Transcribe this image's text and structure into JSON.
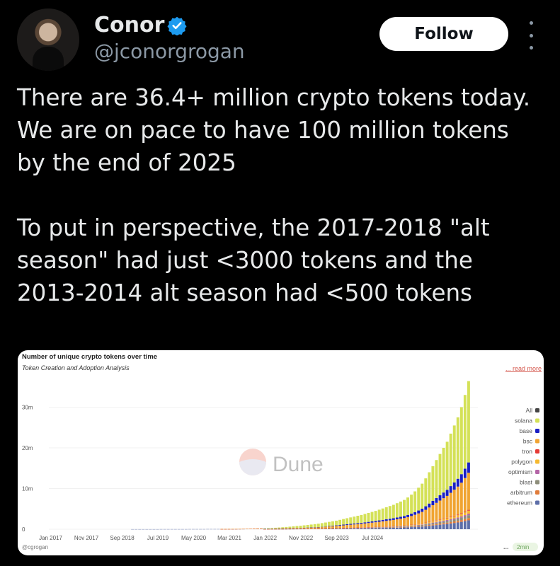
{
  "author": {
    "name": "Conor",
    "handle": "@jconorgrogan",
    "follow_label": "Follow"
  },
  "tweet": {
    "paragraph1": "There are 36.4+ million crypto tokens today. We are on pace to have 100 million tokens by the end of 2025",
    "paragraph2": "To put in perspective, the  2017-2018 \"alt season\" had just <3000 tokens and the 2013-2014 alt season had <500 tokens"
  },
  "colors": {
    "background": "#000000",
    "verified": "#1d9bf0",
    "solana": "#d4e157",
    "base": "#1a1fc4",
    "bsc": "#f0a431",
    "tron": "#e53935",
    "polygon": "#f5b930",
    "optimism": "#b565a7",
    "blast": "#8d8d7a",
    "arbitrum": "#e07b39",
    "ethereum": "#5d6ea8",
    "all": "#444444"
  },
  "card": {
    "title": "Number of unique crypto tokens over time",
    "subtitle": "Token Creation and Adoption Analysis",
    "read_more": "... read more",
    "watermark": "Dune",
    "credit": "@cgrogan",
    "footer_dots": "...",
    "footer_badge": "2min"
  },
  "chart_data": {
    "type": "bar",
    "stacked": true,
    "title": "Number of unique crypto tokens over time",
    "subtitle": "Token Creation and Adoption Analysis",
    "y_ticks": [
      "0",
      "10m",
      "20m",
      "30m"
    ],
    "ylim": [
      0,
      36400000
    ],
    "x_ticks": [
      "Jan 2017",
      "Nov 2017",
      "Sep 2018",
      "Jul 2019",
      "May 2020",
      "Mar 2021",
      "Jan 2022",
      "Nov 2022",
      "Sep 2023",
      "Jul 2024"
    ],
    "legend": [
      "All",
      "solana",
      "base",
      "bsc",
      "tron",
      "polygon",
      "optimism",
      "blast",
      "arbitrum",
      "ethereum"
    ],
    "legend_placement": "right",
    "grid": true,
    "monthly_totals_millions": [
      0,
      0,
      0,
      0,
      0,
      0,
      0,
      0,
      0,
      0,
      0,
      0,
      0,
      0,
      0,
      0,
      0,
      0,
      0,
      0,
      0,
      0,
      0,
      0.01,
      0.01,
      0.01,
      0.01,
      0.01,
      0.01,
      0.01,
      0.01,
      0.02,
      0.02,
      0.02,
      0.02,
      0.02,
      0.02,
      0.02,
      0.02,
      0.03,
      0.03,
      0.03,
      0.03,
      0.03,
      0.04,
      0.04,
      0.04,
      0.04,
      0.05,
      0.05,
      0.06,
      0.07,
      0.08,
      0.09,
      0.1,
      0.11,
      0.12,
      0.14,
      0.16,
      0.19,
      0.22,
      0.26,
      0.31,
      0.36,
      0.42,
      0.48,
      0.55,
      0.62,
      0.7,
      0.78,
      0.86,
      0.95,
      1.05,
      1.15,
      1.25,
      1.35,
      1.5,
      1.65,
      1.8,
      1.95,
      2.1,
      2.3,
      2.5,
      2.7,
      2.9,
      3.1,
      3.3,
      3.5,
      3.75,
      4.0,
      4.25,
      4.5,
      4.8,
      5.1,
      5.4,
      5.7,
      6.0,
      6.4,
      6.8,
      7.2,
      7.8,
      8.5,
      9.3,
      10.2,
      11.2,
      12.5,
      14.0,
      15.5,
      17.0,
      18.5,
      20.0,
      21.5,
      23.5,
      25.5,
      27.5,
      30.0,
      33.0,
      36.4
    ]
  }
}
